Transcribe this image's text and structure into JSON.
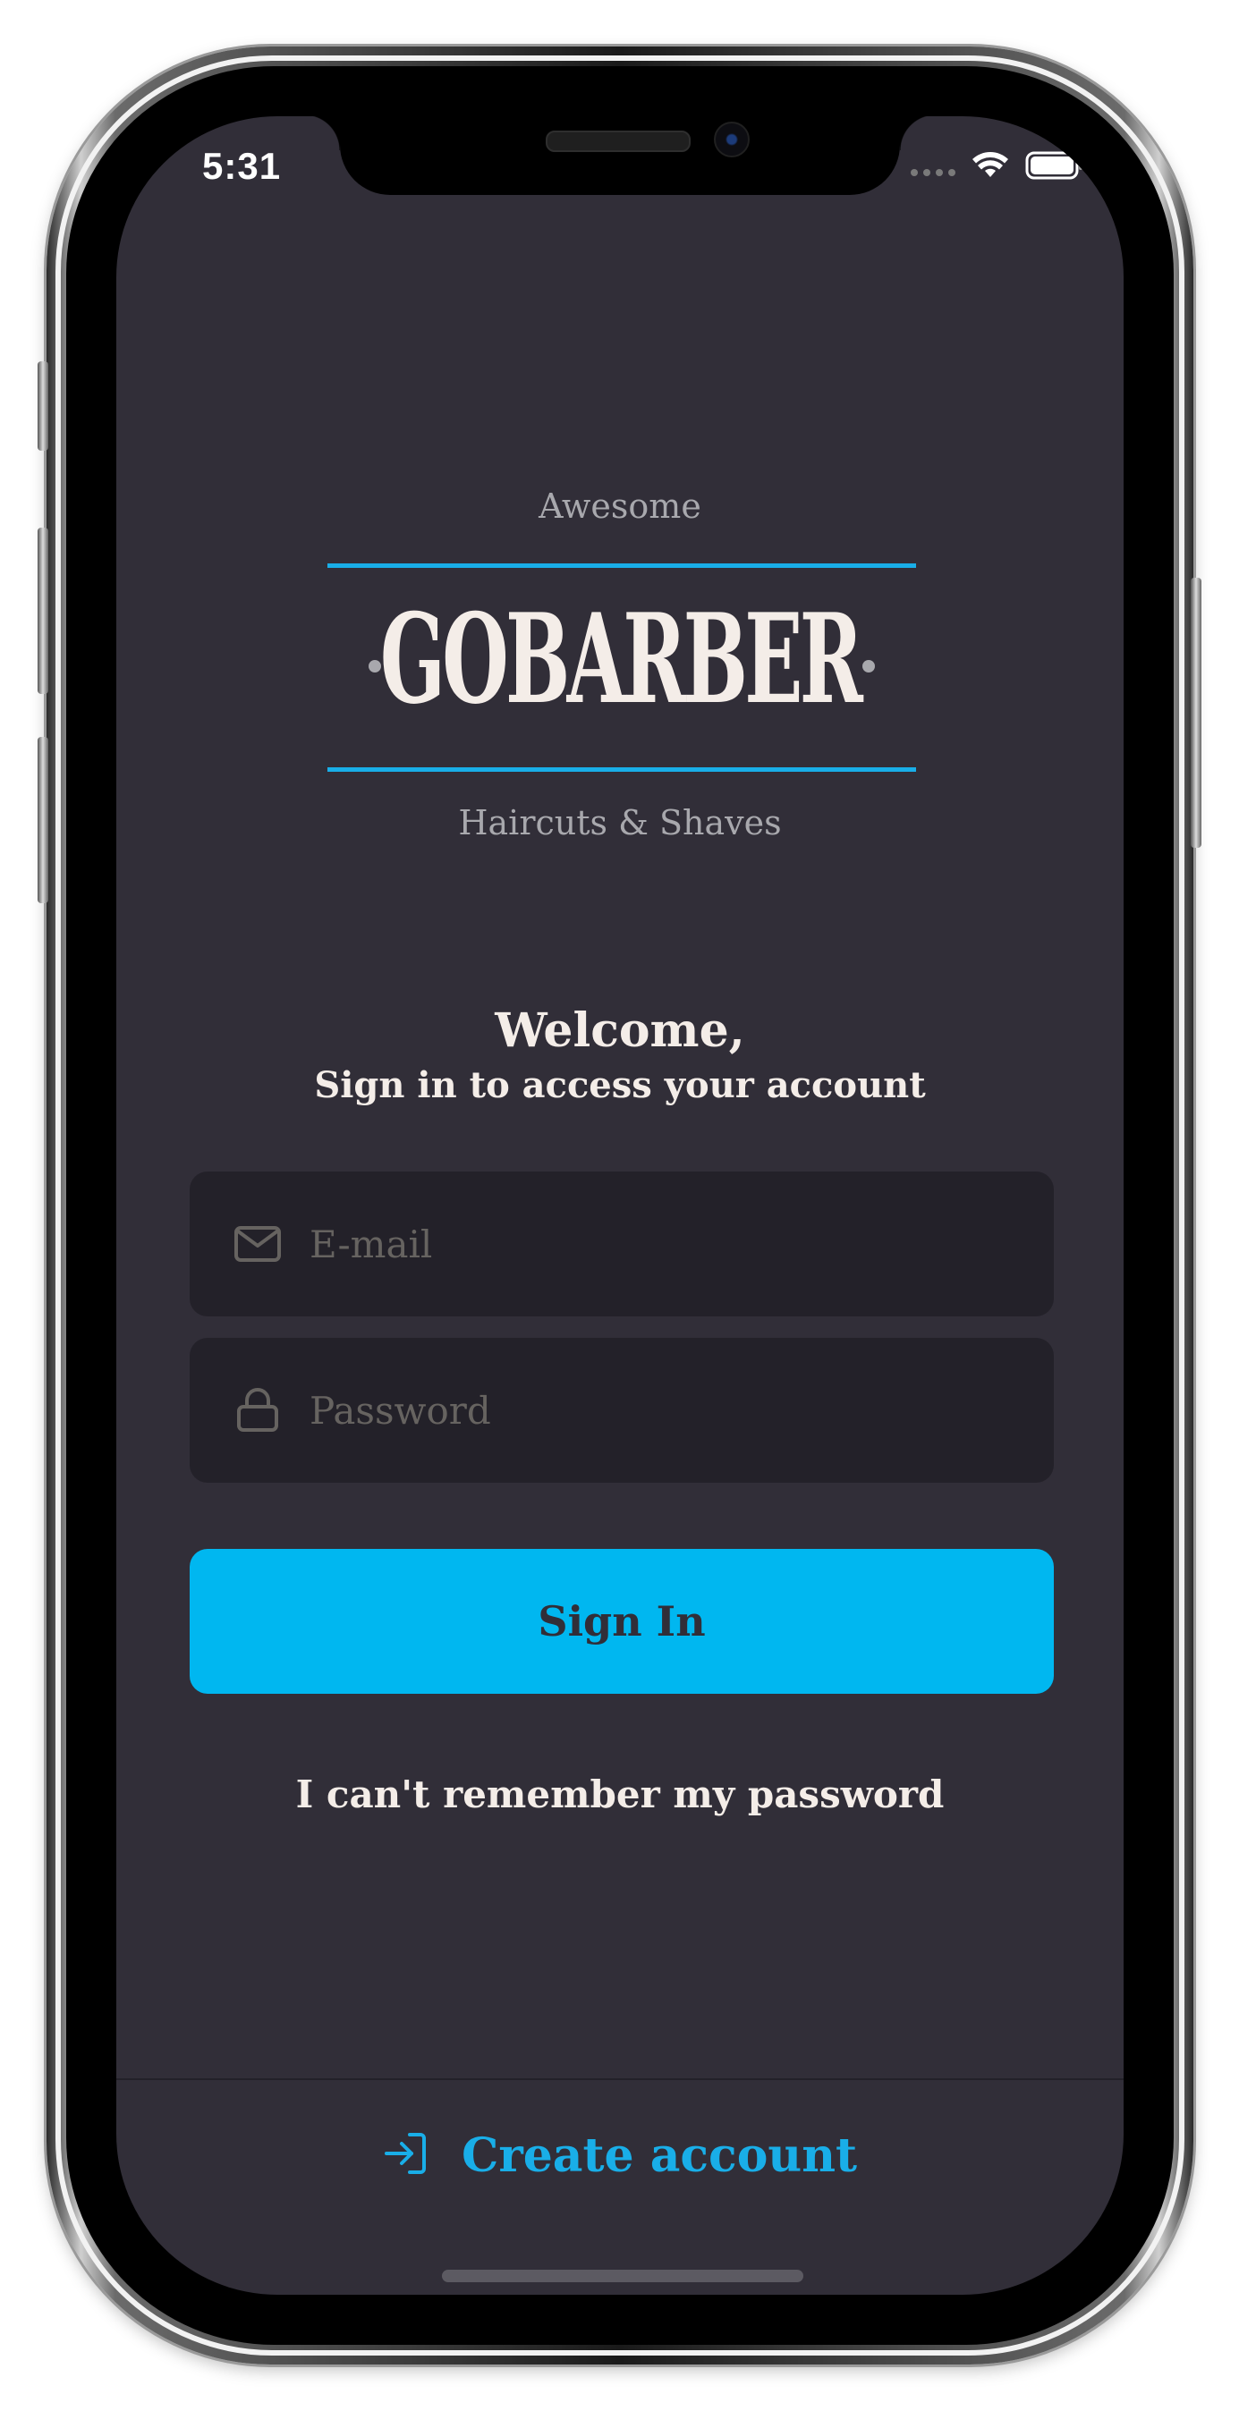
{
  "status_bar": {
    "time": "5:31"
  },
  "logo": {
    "top_text": "Awesome",
    "wordmark": "GOBARBER",
    "bottom_text": "Haircuts & Shaves"
  },
  "welcome": {
    "title": "Welcome,",
    "subtitle": "Sign in to access your account"
  },
  "form": {
    "email_placeholder": "E-mail",
    "email_value": "",
    "password_placeholder": "Password",
    "password_value": "",
    "submit_label": "Sign In",
    "forgot_label": "I can't remember my password"
  },
  "footer": {
    "create_account_label": "Create account"
  },
  "colors": {
    "background": "#312e38",
    "input_background": "#232129",
    "accent": "#00b7f0",
    "text": "#f4ede8",
    "muted": "#666360"
  },
  "icons": {
    "email": "mail-icon",
    "password": "lock-icon",
    "create_account": "log-in-icon"
  }
}
